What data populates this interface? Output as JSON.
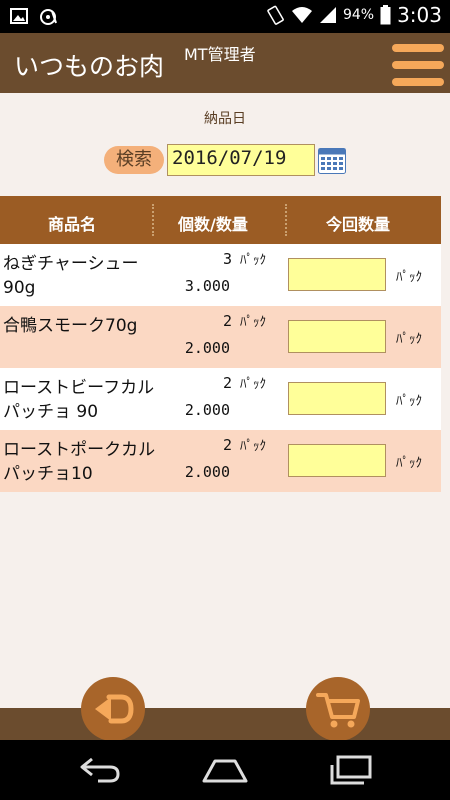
{
  "status_bar": {
    "battery_text": "94%",
    "time": "3:03",
    "icons": [
      "image-icon",
      "sync-icon",
      "rotate-icon",
      "wifi-icon",
      "signal-icon",
      "battery-icon"
    ]
  },
  "app_bar": {
    "title": "いつものお肉",
    "user": "MT管理者",
    "menu_icon": "hamburger-menu-icon"
  },
  "search": {
    "date_label": "納品日",
    "search_label": "検索",
    "date_value": "2016/07/19",
    "calendar_icon": "calendar-icon"
  },
  "table": {
    "headers": [
      "商品名",
      "個数/数量",
      "今回数量"
    ],
    "rows": [
      {
        "name": "ねぎチャーシュー90g",
        "count": "3",
        "unit": "ﾊﾟｯｸ",
        "amount": "3.000",
        "now_value": "",
        "now_unit": "ﾊﾟｯｸ"
      },
      {
        "name": "合鴨スモーク70g",
        "count": "2",
        "unit": "ﾊﾟｯｸ",
        "amount": "2.000",
        "now_value": "",
        "now_unit": "ﾊﾟｯｸ"
      },
      {
        "name": "ローストビーフカルパッチョ 90",
        "count": "2",
        "unit": "ﾊﾟｯｸ",
        "amount": "2.000",
        "now_value": "",
        "now_unit": "ﾊﾟｯｸ"
      },
      {
        "name": "ローストポークカルパッチョ10",
        "count": "2",
        "unit": "ﾊﾟｯｸ",
        "amount": "2.000",
        "now_value": "",
        "now_unit": "ﾊﾟｯｸ"
      }
    ]
  },
  "footer": {
    "back_icon": "back-arrow-icon",
    "cart_icon": "cart-icon"
  },
  "navbar": {
    "icons": [
      "nav-back-icon",
      "nav-home-icon",
      "nav-recents-icon"
    ]
  },
  "colors": {
    "app_bar": "#6b4c2e",
    "accent": "#f5a85a",
    "header_bar": "#9b5c24",
    "row_alt": "#fbd8c3",
    "input_bg": "#ffff99"
  }
}
